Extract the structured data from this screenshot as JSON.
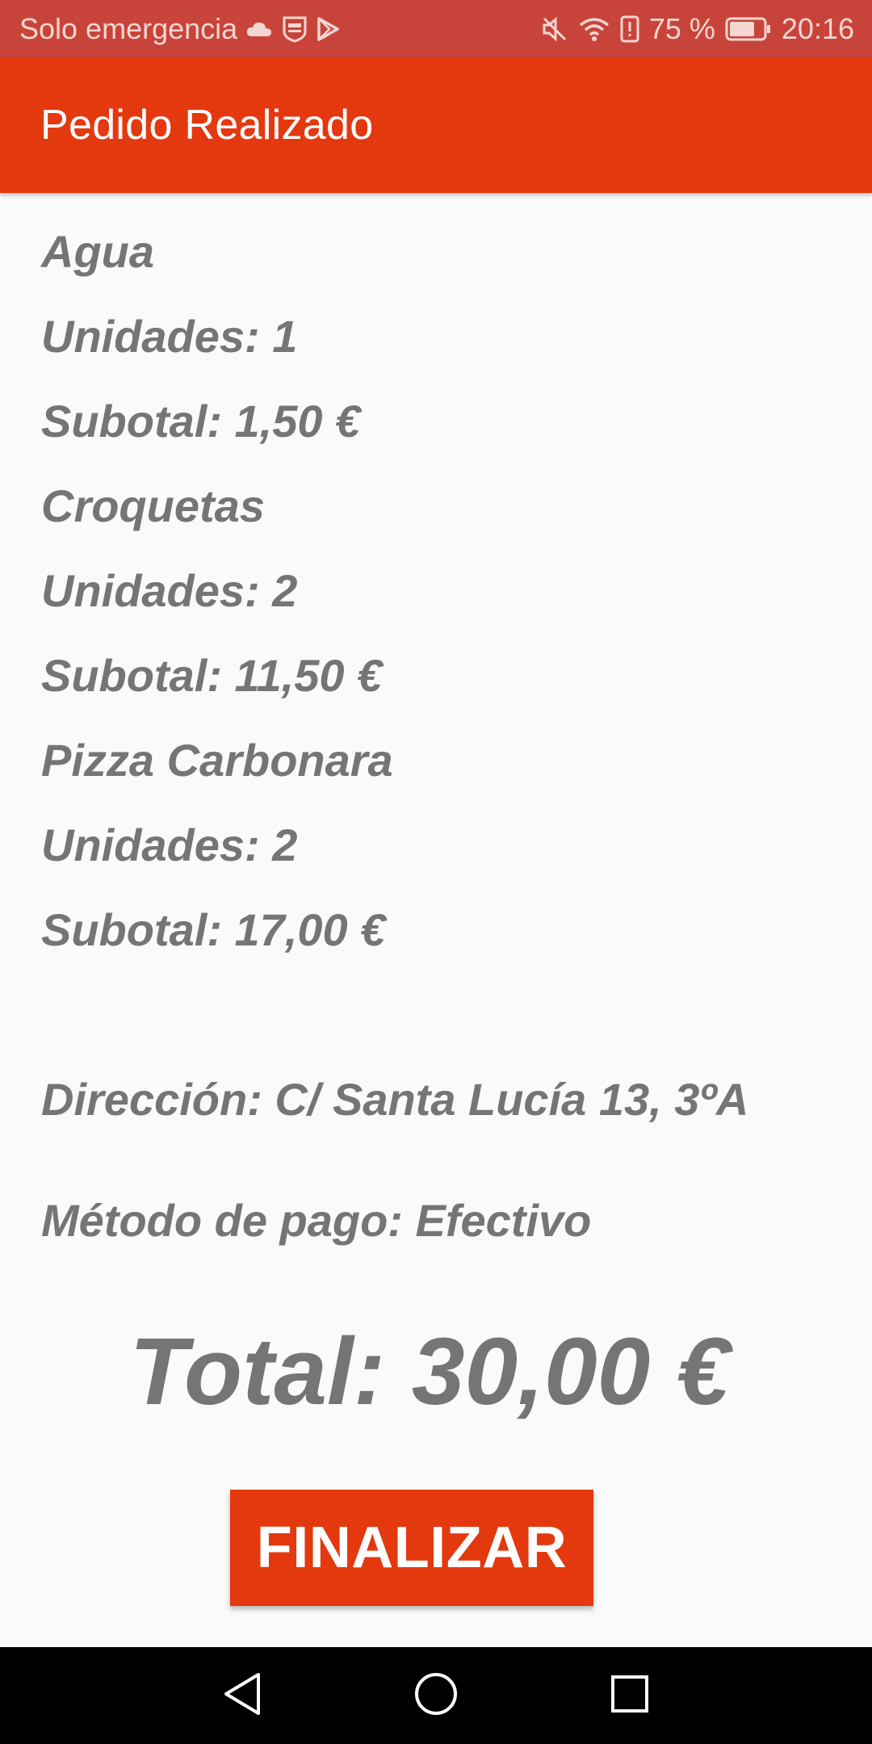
{
  "status_bar": {
    "carrier": "Solo emergencia",
    "battery_percent": "75 %",
    "time": "20:16",
    "icons": [
      "cloud-icon",
      "as-app-icon",
      "play-store-icon",
      "mute-icon",
      "wifi-icon",
      "alert-icon",
      "battery-icon"
    ],
    "battery_level": 0.75
  },
  "app_bar": {
    "title": "Pedido Realizado"
  },
  "order": {
    "items": [
      {
        "name": "Agua",
        "units": "Unidades: 1",
        "subtotal": "Subotal: 1,50 €"
      },
      {
        "name": "Croquetas",
        "units": "Unidades: 2",
        "subtotal": "Subotal: 11,50 €"
      },
      {
        "name": "Pizza Carbonara",
        "units": "Unidades: 2",
        "subtotal": "Subotal: 17,00 €"
      }
    ],
    "address": "Dirección: C/ Santa Lucía 13, 3ºA",
    "payment": "Método de pago: Efectivo",
    "total": "Total: 30,00 €"
  },
  "actions": {
    "finalize_label": "FINALIZAR"
  },
  "nav_bar": {
    "icons": [
      "back-icon",
      "home-icon",
      "recents-icon"
    ]
  },
  "colors": {
    "accent": "#E4380F",
    "status_bar": "#C8443A",
    "text": "#757575",
    "background": "#FAFAFA"
  }
}
